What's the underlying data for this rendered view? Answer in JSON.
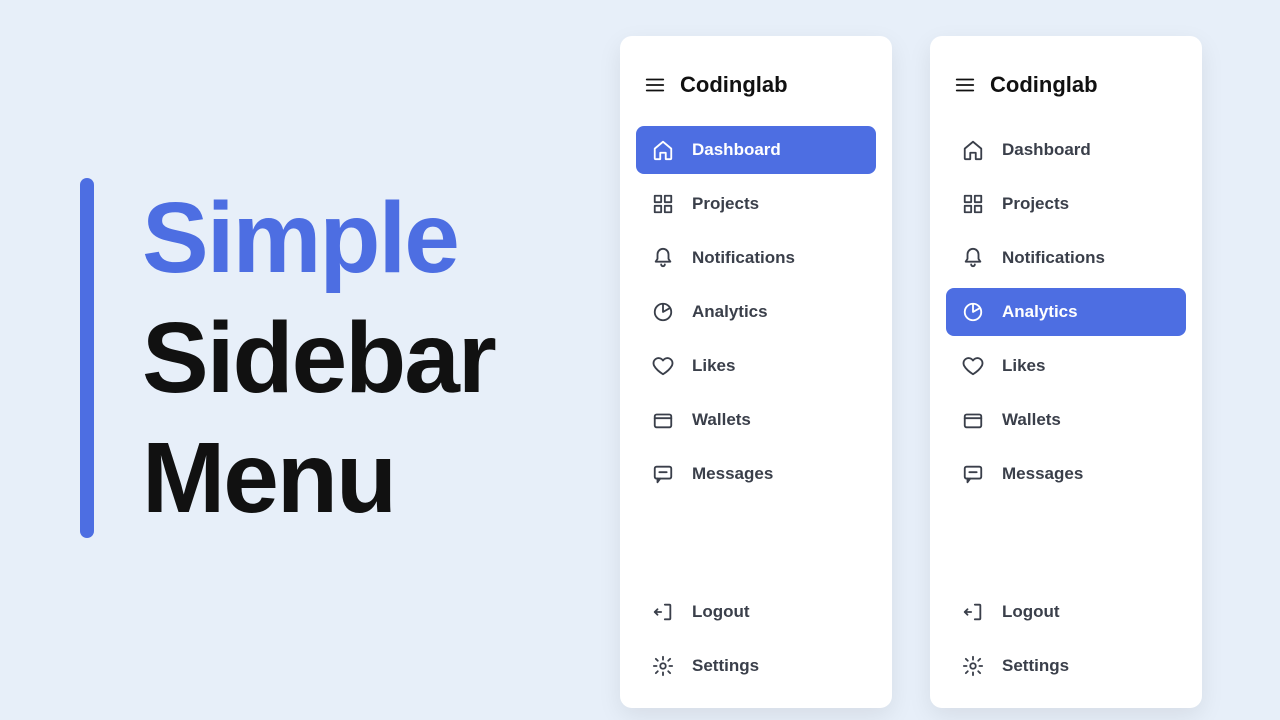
{
  "hero": {
    "line1": "Simple",
    "line2": "Sidebar",
    "line3": "Menu"
  },
  "brand": "Codinglab",
  "accent": "#4d6ee2",
  "menu": [
    {
      "id": "dashboard",
      "label": "Dashboard",
      "icon": "home"
    },
    {
      "id": "projects",
      "label": "Projects",
      "icon": "grid"
    },
    {
      "id": "notifications",
      "label": "Notifications",
      "icon": "bell"
    },
    {
      "id": "analytics",
      "label": "Analytics",
      "icon": "pie"
    },
    {
      "id": "likes",
      "label": "Likes",
      "icon": "heart"
    },
    {
      "id": "wallets",
      "label": "Wallets",
      "icon": "wallet"
    },
    {
      "id": "messages",
      "label": "Messages",
      "icon": "chat"
    }
  ],
  "footer": [
    {
      "id": "logout",
      "label": "Logout",
      "icon": "logout"
    },
    {
      "id": "settings",
      "label": "Settings",
      "icon": "gear"
    }
  ],
  "sidebars": {
    "a": {
      "active": "dashboard"
    },
    "b": {
      "active": "analytics"
    }
  }
}
